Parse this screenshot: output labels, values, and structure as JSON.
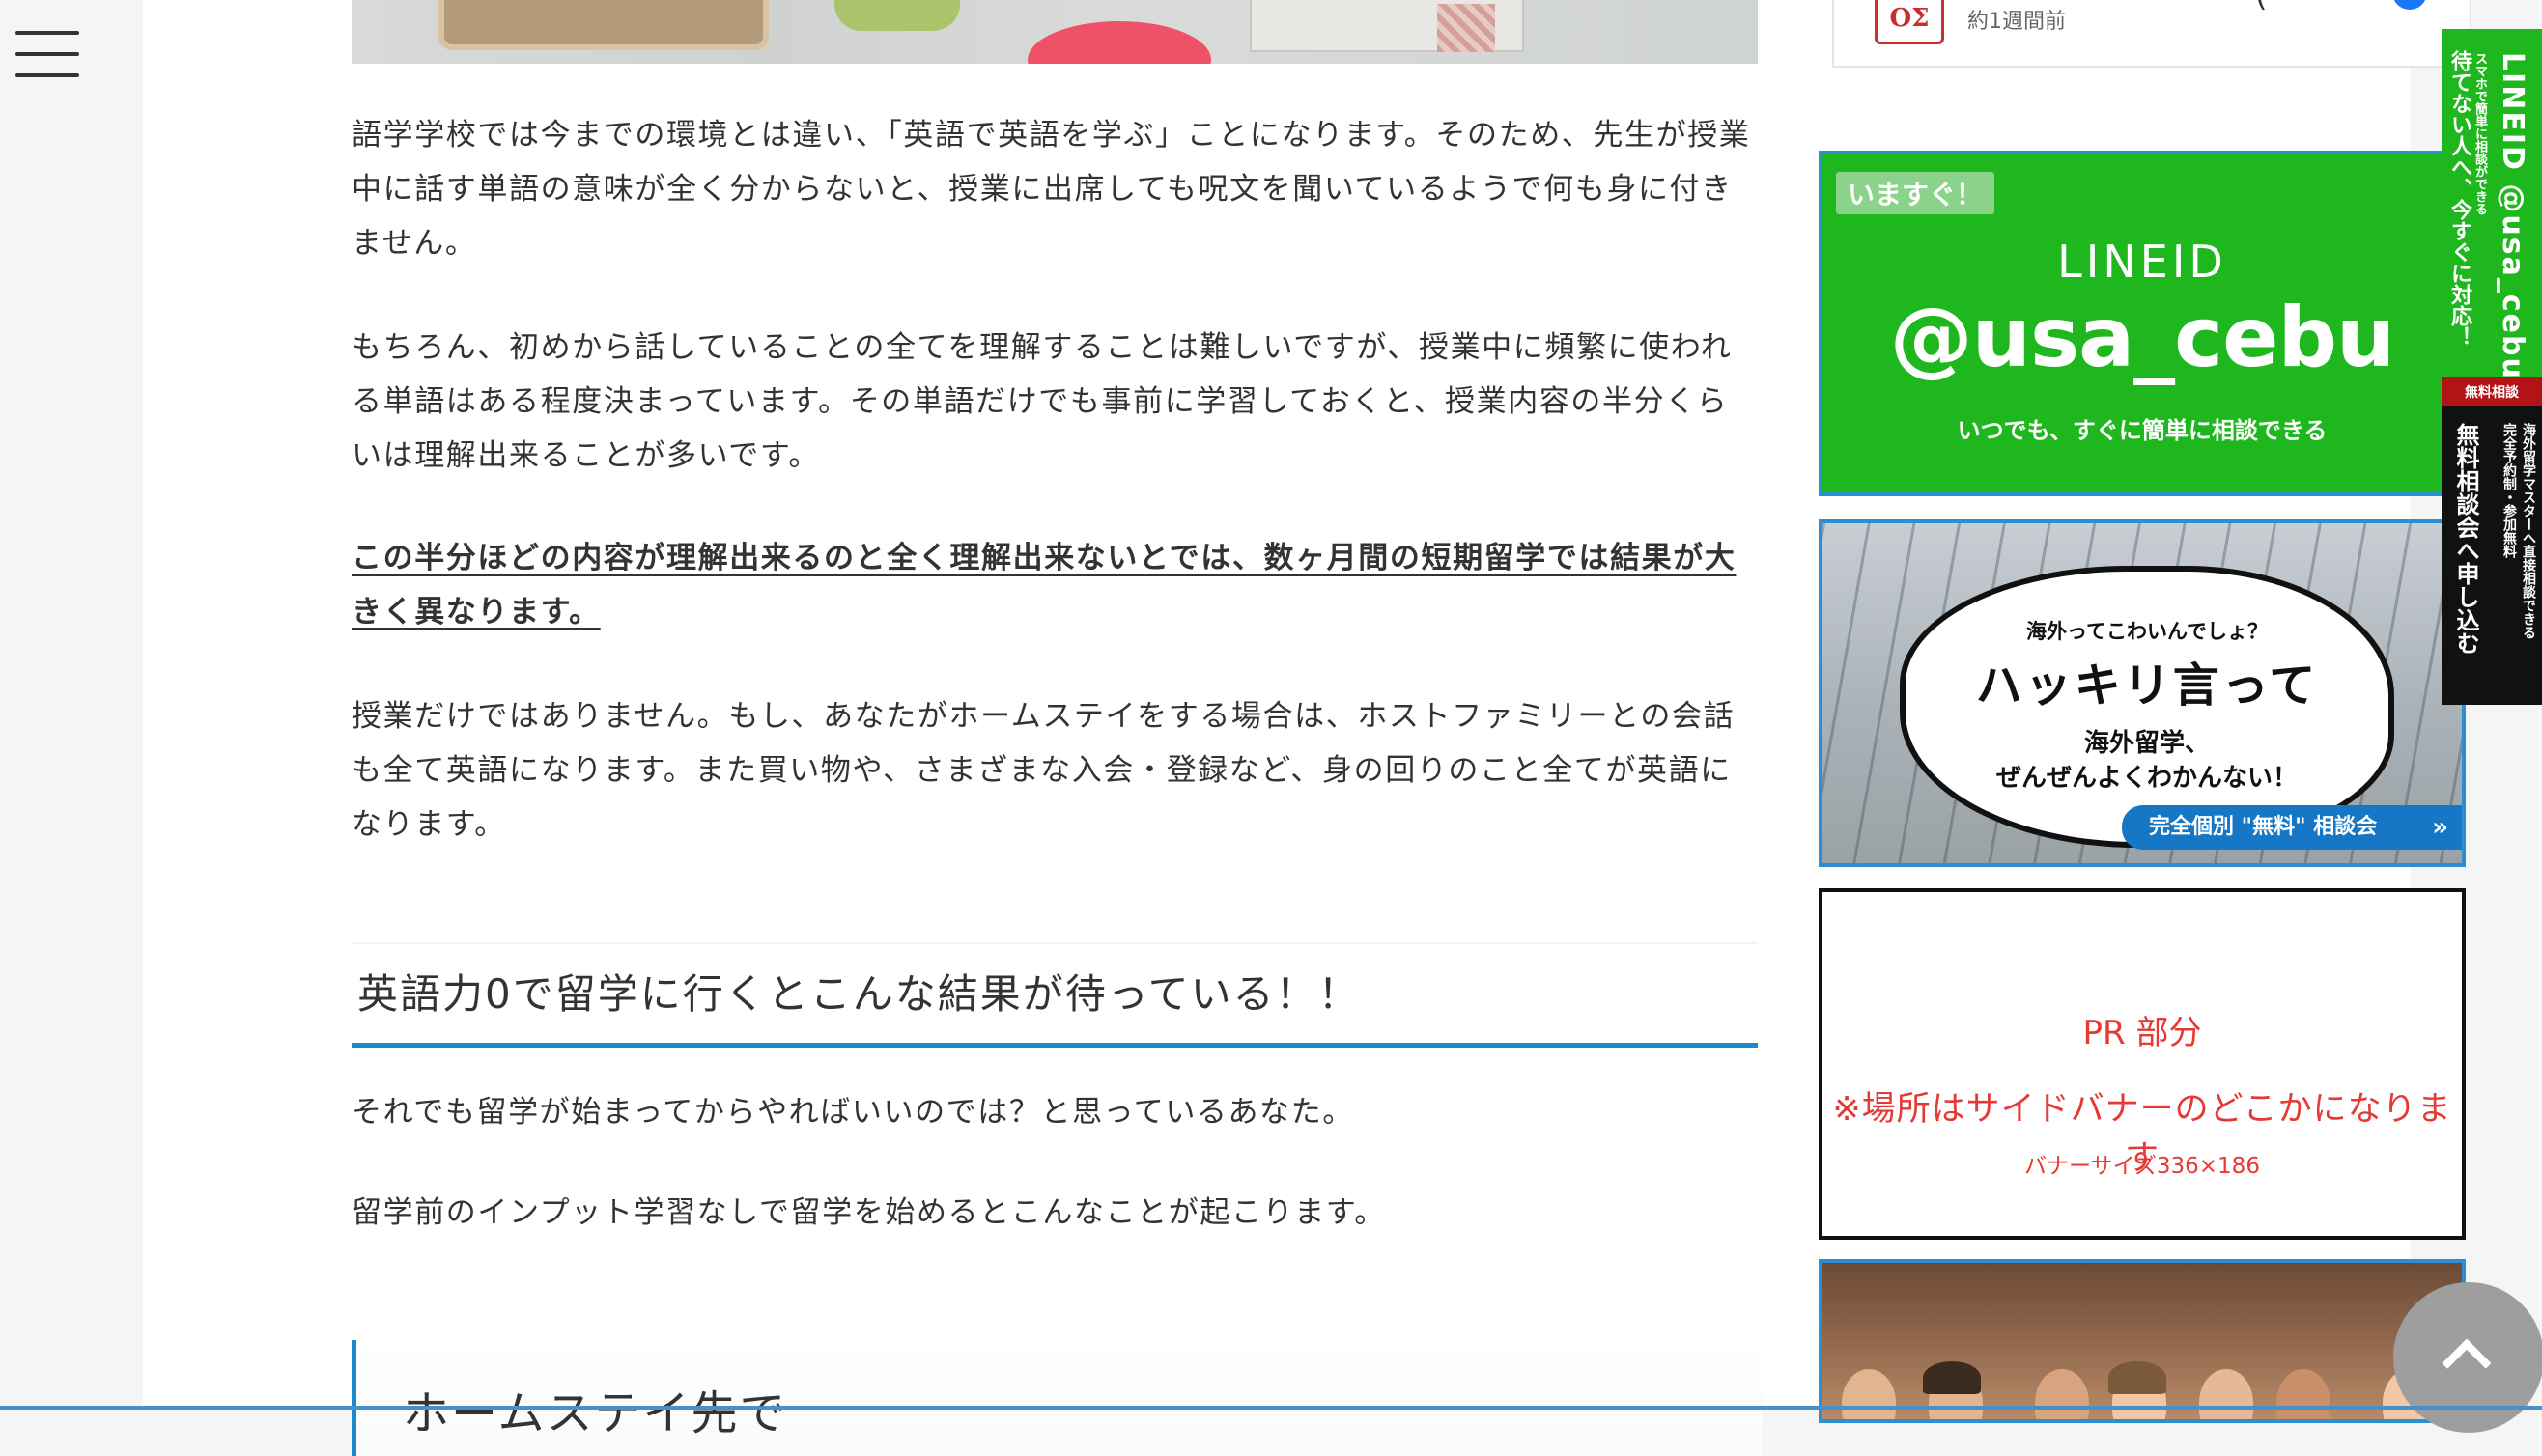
{
  "colors": {
    "accent_blue": "#1e88c9",
    "line_green": "#1eb71e",
    "pr_red": "#e53935",
    "scroll_button_gray": "#9e9e9e"
  },
  "header": {
    "menu_icon": "hamburger-menu-icon"
  },
  "article": {
    "paragraphs": [
      "語学学校では今までの環境とは違い、「英語で英語を学ぶ」ことになります。そのため、先生が授業中に話す単語の意味が全く分からないと、授業に出席しても呪文を聞いているようで何も身に付きません。",
      "もちろん、初めから話していることの全てを理解することは難しいですが、授業中に頻繁に使われる単語はある程度決まっています。その単語だけでも事前に学習しておくと、授業内容の半分くらいは理解出来ることが多いです。",
      "この半分ほどの内容が理解出来るのと全く理解出来ないとでは、数ヶ月間の短期留学では結果が大きく異なります。",
      "授業だけではありません。もし、あなたがホームステイをする場合は、ホストファミリーとの会話も全て英語になります。また買い物や、さまざまな入会・登録など、身の回りのこと全てが英語になります。"
    ],
    "heading_h2": "英語力0で留学に行くとこんな結果が待っている！！",
    "paragraphs_after": [
      "それでも留学が始まってからやればいいのでは？と思っているあなた。",
      "留学前のインプット学習なしで留学を始めるとこんなことが起こります。"
    ],
    "heading_h3_partial": "ホームステイ先で"
  },
  "sidebar": {
    "social": {
      "logo_text": "ΟΣ",
      "time": "約1週間前",
      "paren": "("
    },
    "line_banner": {
      "badge": "いますぐ！",
      "lineid_label": "LINEID",
      "handle": "@usa_cebu",
      "sub": "いつでも、すぐに簡単に相談できる"
    },
    "manga_banner": {
      "line1": "海外ってこわいんでしょ？",
      "line2": "ハッキリ言って",
      "line3": "海外留学、",
      "line4": "ぜんぜんよくわかんない！",
      "cta": "完全個別 \"無料\" 相談会",
      "cta_arrow": "»"
    },
    "pr_box": {
      "line1": "PR 部分",
      "line2": "※場所はサイドバナーのどこかになります",
      "line3": "バナーサイズ336×186"
    }
  },
  "side_tab": {
    "main": "LINEID @usa_cebu",
    "small": "スマホで簡単に相談ができる",
    "big": "待てない人へ、今すぐに対応！",
    "free_label": "無料相談",
    "black_big": "無料相談会へ申し込む",
    "black_small1": "完全予約制・参加無料",
    "black_small2": "海外留学マスターへ直接相談できる"
  },
  "back_to_top": {
    "icon": "chevron-up-icon"
  }
}
